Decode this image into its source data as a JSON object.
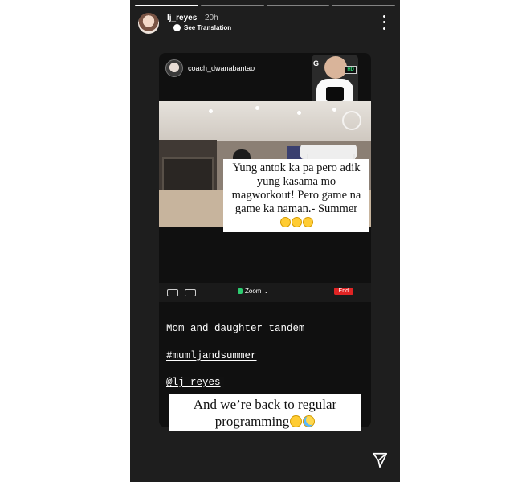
{
  "story": {
    "progress_segments": 4,
    "progress_done": 1,
    "header": {
      "username": "lj_reyes",
      "time": "20h",
      "translate": "See Translation"
    },
    "repost": {
      "username": "coach_dwanabantao",
      "pip_logo": "G",
      "pip_tag": "HD",
      "caption": "Yung antok ka pa pero adik yung kasama mo magworkout! Pero game na game ka naman.- Summer",
      "caption_emoji_count": 3,
      "zoom_label": "Zoom",
      "end_label": "End"
    },
    "text_lines": {
      "line1": "Mom and daughter tandem",
      "hashtag": "#mumljandsummer",
      "mention": "@lj_reyes"
    },
    "caption2": "And we’re back to regular programming",
    "icons": [
      "more-options-icon",
      "globe-icon",
      "send-icon",
      "mic-icon",
      "camera-icon",
      "shield-icon"
    ]
  }
}
